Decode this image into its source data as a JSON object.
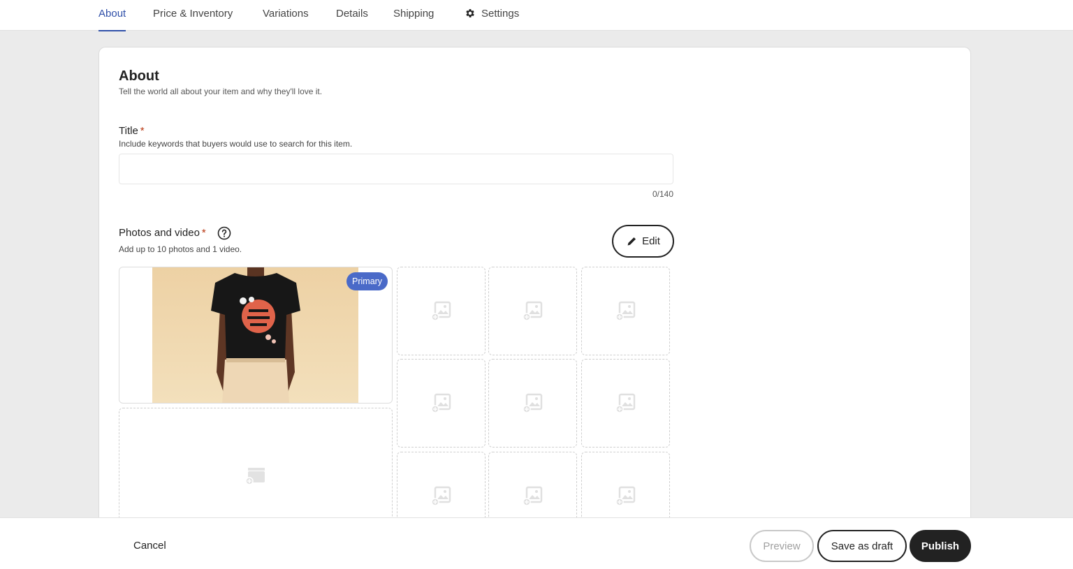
{
  "tabs": [
    {
      "label": "About",
      "active": true
    },
    {
      "label": "Price & Inventory"
    },
    {
      "label": "Variations"
    },
    {
      "label": "Details"
    },
    {
      "label": "Shipping"
    },
    {
      "label": "Settings",
      "icon": "gear-icon"
    }
  ],
  "about": {
    "title": "About",
    "subtitle": "Tell the world all about your item and why they'll love it."
  },
  "title_field": {
    "label": "Title",
    "required_mark": "*",
    "help": "Include keywords that buyers would use to search for this item.",
    "value": "",
    "placeholder": "",
    "counter": "0/140"
  },
  "photos": {
    "label": "Photos and video",
    "required_mark": "*",
    "help_icon": "question-circle-icon",
    "help": "Add up to 10 photos and 1 video.",
    "edit_label": "Edit",
    "edit_icon": "pencil-icon",
    "primary_badge": "Primary",
    "primary_image": "man in black t-shirt with graphic print",
    "empty_slot_icon": "add-photo-icon",
    "video_slot_icon": "add-video-icon"
  },
  "footer": {
    "cancel": "Cancel",
    "preview": "Preview",
    "save_draft": "Save as draft",
    "publish": "Publish"
  },
  "colors": {
    "accent": "#2f4fa8",
    "badge": "#4a6ac8",
    "required": "#b8350f",
    "publish_bg": "#222222"
  }
}
